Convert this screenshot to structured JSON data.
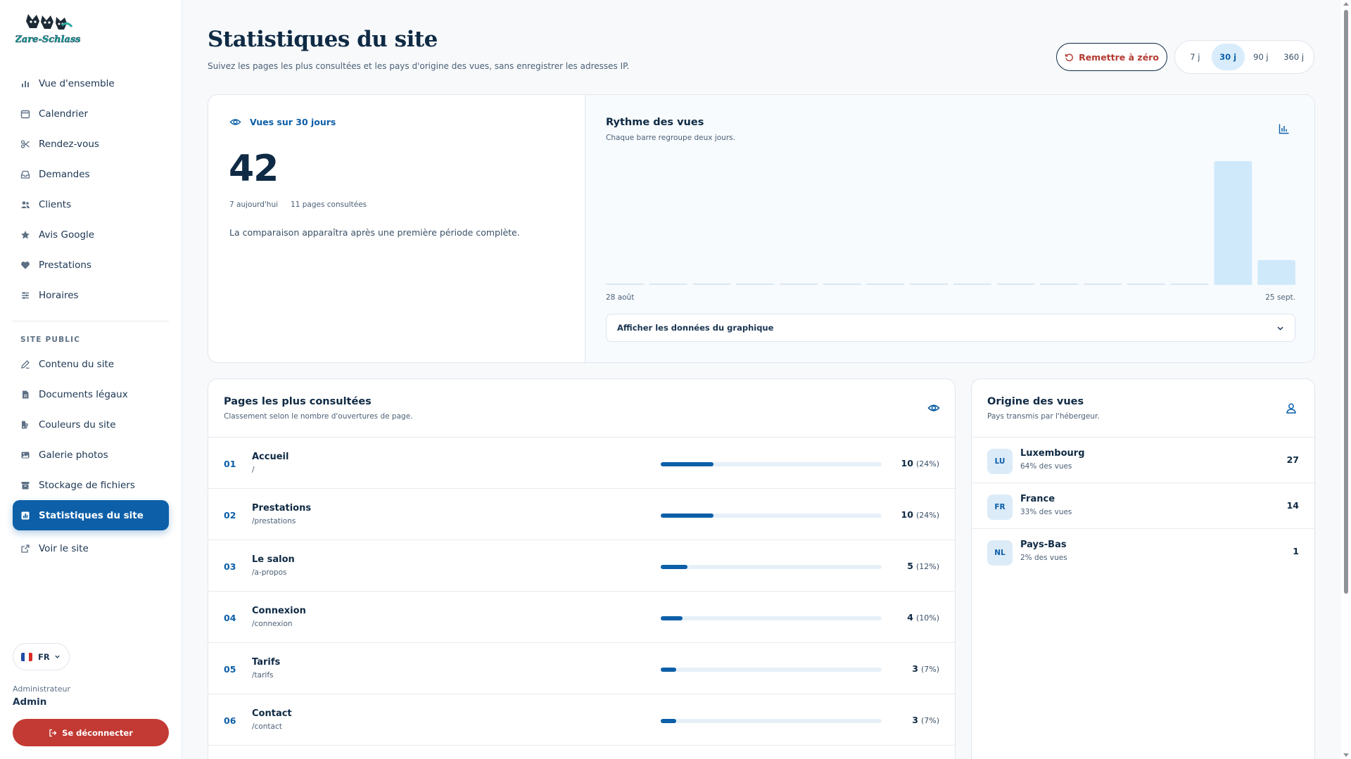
{
  "brand": {
    "logo_text": "Zare-Schlass"
  },
  "sidebar": {
    "items": [
      {
        "label": "Vue d'ensemble",
        "icon": "bar-chart-icon"
      },
      {
        "label": "Calendrier",
        "icon": "calendar-icon"
      },
      {
        "label": "Rendez-vous",
        "icon": "scissors-icon"
      },
      {
        "label": "Demandes",
        "icon": "inbox-icon"
      },
      {
        "label": "Clients",
        "icon": "users-icon"
      },
      {
        "label": "Avis Google",
        "icon": "star-icon"
      },
      {
        "label": "Prestations",
        "icon": "heart-icon"
      },
      {
        "label": "Horaires",
        "icon": "sliders-icon"
      }
    ],
    "section_label": "SITE PUBLIC",
    "public_items": [
      {
        "label": "Contenu du site",
        "icon": "edit-icon"
      },
      {
        "label": "Documents légaux",
        "icon": "document-icon"
      },
      {
        "label": "Couleurs du site",
        "icon": "palette-icon"
      },
      {
        "label": "Galerie photos",
        "icon": "image-icon"
      },
      {
        "label": "Stockage de fichiers",
        "icon": "archive-icon"
      },
      {
        "label": "Statistiques du site",
        "icon": "chart-icon",
        "active": true
      }
    ],
    "view_site": "Voir le site",
    "language": "FR",
    "admin_role": "Administrateur",
    "admin_name": "Admin",
    "logout_label": "Se déconnecter"
  },
  "header": {
    "title": "Statistiques du site",
    "subtitle": "Suivez les pages les plus consultées et les pays d'origine des vues, sans enregistrer les adresses IP.",
    "reset_label": "Remettre à zéro",
    "ranges": [
      "7 j",
      "30 j",
      "90 j",
      "360 j"
    ],
    "selected_range": "30 j"
  },
  "summary": {
    "heading": "Vues sur 30 jours",
    "total_views": "42",
    "today": "7 aujourd'hui",
    "pages_viewed": "11 pages consultées",
    "note": "La comparaison apparaîtra après une première période complète."
  },
  "rhythm": {
    "title": "Rythme des vues",
    "subtitle": "Chaque barre regroupe deux jours.",
    "x_start": "28 août",
    "x_end": "25 sept.",
    "toggle_label": "Afficher les données du graphique"
  },
  "chart_data": {
    "type": "bar",
    "values": [
      0,
      0,
      0,
      0,
      0,
      0,
      0,
      0,
      0,
      0,
      0,
      0,
      0,
      0,
      35,
      7
    ],
    "x_start": "28 août",
    "x_end": "25 sept.",
    "bar_color": "#cfe9fb",
    "baseline_color": "#dbe7f1"
  },
  "pages": {
    "title": "Pages les plus consultées",
    "subtitle": "Classement selon le nombre d'ouvertures de page.",
    "rows": [
      {
        "rank": "01",
        "name": "Accueil",
        "path": "/",
        "views": "10",
        "pct": "(24%)",
        "share": 0.24
      },
      {
        "rank": "02",
        "name": "Prestations",
        "path": "/prestations",
        "views": "10",
        "pct": "(24%)",
        "share": 0.24
      },
      {
        "rank": "03",
        "name": "Le salon",
        "path": "/a-propos",
        "views": "5",
        "pct": "(12%)",
        "share": 0.12
      },
      {
        "rank": "04",
        "name": "Connexion",
        "path": "/connexion",
        "views": "4",
        "pct": "(10%)",
        "share": 0.1
      },
      {
        "rank": "05",
        "name": "Tarifs",
        "path": "/tarifs",
        "views": "3",
        "pct": "(7%)",
        "share": 0.07
      },
      {
        "rank": "06",
        "name": "Contact",
        "path": "/contact",
        "views": "3",
        "pct": "(7%)",
        "share": 0.07
      }
    ]
  },
  "origin": {
    "title": "Origine des vues",
    "subtitle": "Pays transmis par l'hébergeur.",
    "rows": [
      {
        "code": "LU",
        "country": "Luxembourg",
        "share": "64% des vues",
        "views": "27"
      },
      {
        "code": "FR",
        "country": "France",
        "share": "33% des vues",
        "views": "14"
      },
      {
        "code": "NL",
        "country": "Pays-Bas",
        "share": "2% des vues",
        "views": "1"
      }
    ]
  },
  "colors": {
    "accent": "#0d5fa8",
    "danger": "#c23a33",
    "ink": "#0f2a44"
  }
}
